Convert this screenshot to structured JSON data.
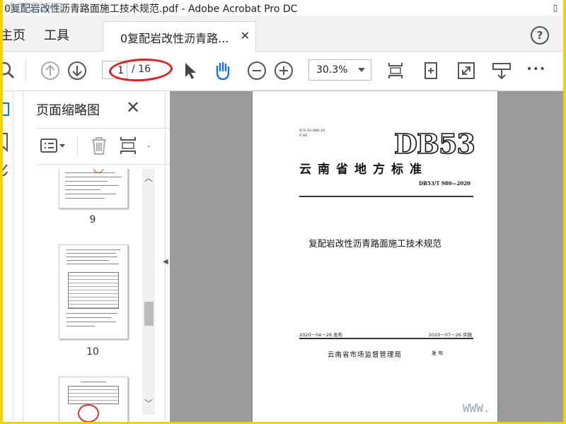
{
  "window": {
    "title": "0复配岩改性沥青路面施工技术规范.pdf - Adobe Acrobat Pro DC",
    "watermark_top": "中国道桥网"
  },
  "menu": {
    "home": "主页",
    "tools": "工具",
    "doc_tab": "0复配岩改性沥青路...",
    "help_icon": "help-icon"
  },
  "toolbar": {
    "current_page": "1",
    "total_pages": "/ 16",
    "zoom": "30.3%",
    "more": "•••"
  },
  "panel": {
    "title": "页面缩略图",
    "thumbnails": [
      {
        "label": "9"
      },
      {
        "label": "10"
      }
    ]
  },
  "document": {
    "ics": "ICS 93.080.20",
    "ics2": "P 66",
    "code": "DB53",
    "standard_name": "云南省地方标准",
    "standard_no": "DB53/T 980—2020",
    "title": "复配岩改性沥青路面施工技术规范",
    "release_date": "2020－04－26 发布",
    "implement_date": "2020－07－26 实施",
    "issuer": "云南省市场监督管理局",
    "issued": "发 布"
  },
  "footer": {
    "watermark": "WWW. c"
  },
  "colors": {
    "highlight_circle": "#e21d1d",
    "doc_background": "#9b9b9b",
    "frame": "#f0d400"
  }
}
